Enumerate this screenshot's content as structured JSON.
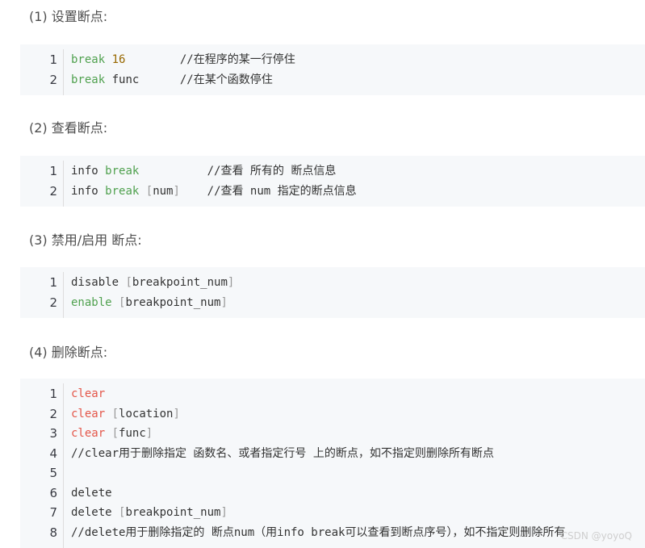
{
  "sections": [
    {
      "heading": "(1) 设置断点:",
      "lines": [
        {
          "num": "1",
          "segments": [
            {
              "t": "break",
              "c": "kw"
            },
            {
              "t": " "
            },
            {
              "t": "16",
              "c": "num"
            },
            {
              "t": "        //在程序的某一行停住"
            }
          ]
        },
        {
          "num": "2",
          "segments": [
            {
              "t": "break",
              "c": "kw"
            },
            {
              "t": " func      //在某个函数停住"
            }
          ]
        }
      ]
    },
    {
      "heading": "(2) 查看断点:",
      "lines": [
        {
          "num": "1",
          "segments": [
            {
              "t": "info "
            },
            {
              "t": "break",
              "c": "kw"
            },
            {
              "t": "          //查看 所有的 断点信息"
            }
          ]
        },
        {
          "num": "2",
          "segments": [
            {
              "t": "info "
            },
            {
              "t": "break",
              "c": "kw"
            },
            {
              "t": " "
            },
            {
              "t": "[",
              "c": "br"
            },
            {
              "t": "num"
            },
            {
              "t": "]",
              "c": "br"
            },
            {
              "t": "    //查看 num 指定的断点信息"
            }
          ]
        }
      ]
    },
    {
      "heading": "(3) 禁用/启用 断点:",
      "lines": [
        {
          "num": "1",
          "segments": [
            {
              "t": "disable "
            },
            {
              "t": "[",
              "c": "br"
            },
            {
              "t": "breakpoint_num"
            },
            {
              "t": "]",
              "c": "br"
            }
          ]
        },
        {
          "num": "2",
          "segments": [
            {
              "t": "enable",
              "c": "kw"
            },
            {
              "t": " "
            },
            {
              "t": "[",
              "c": "br"
            },
            {
              "t": "breakpoint_num"
            },
            {
              "t": "]",
              "c": "br"
            }
          ]
        }
      ]
    },
    {
      "heading": "(4) 删除断点:",
      "lines": [
        {
          "num": "1",
          "segments": [
            {
              "t": "clear",
              "c": "fn"
            }
          ]
        },
        {
          "num": "2",
          "segments": [
            {
              "t": "clear",
              "c": "fn"
            },
            {
              "t": " "
            },
            {
              "t": "[",
              "c": "br"
            },
            {
              "t": "location"
            },
            {
              "t": "]",
              "c": "br"
            }
          ]
        },
        {
          "num": "3",
          "segments": [
            {
              "t": "clear",
              "c": "fn"
            },
            {
              "t": " "
            },
            {
              "t": "[",
              "c": "br"
            },
            {
              "t": "func"
            },
            {
              "t": "]",
              "c": "br"
            }
          ]
        },
        {
          "num": "4",
          "segments": [
            {
              "t": "//clear用于删除指定 函数名、或者指定行号 上的断点，如不指定则删除所有断点"
            }
          ]
        },
        {
          "num": "5",
          "segments": []
        },
        {
          "num": "6",
          "segments": [
            {
              "t": "delete"
            }
          ]
        },
        {
          "num": "7",
          "segments": [
            {
              "t": "delete "
            },
            {
              "t": "[",
              "c": "br"
            },
            {
              "t": "breakpoint_num"
            },
            {
              "t": "]",
              "c": "br"
            }
          ]
        },
        {
          "num": "8",
          "segments": [
            {
              "t": "//delete用于删除指定的 断点num（用info break可以查看到断点序号），如不指定则删除所有"
            }
          ]
        }
      ]
    }
  ],
  "watermark": "CSDN @yoyoQ"
}
